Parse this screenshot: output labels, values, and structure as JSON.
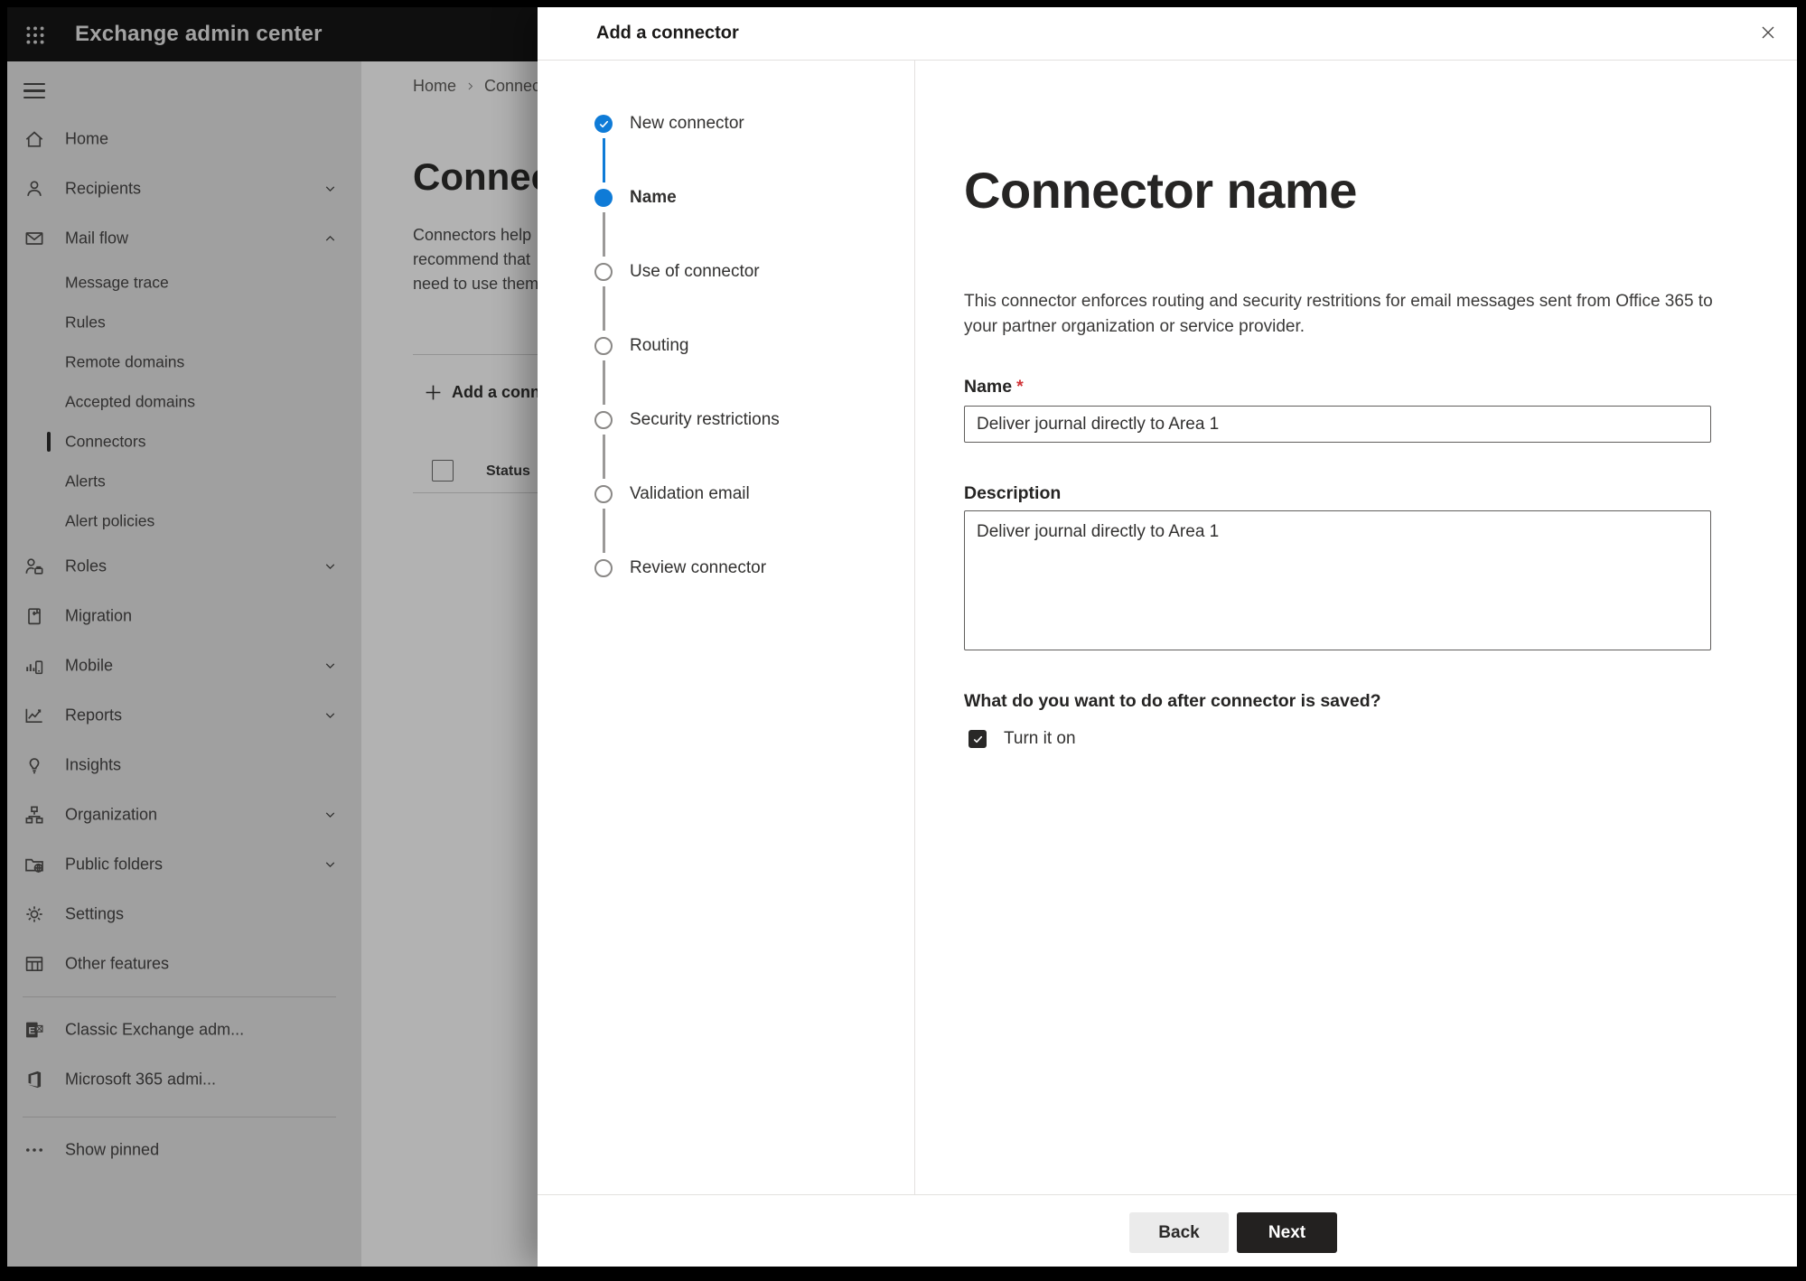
{
  "topbar": {
    "title": "Exchange admin center"
  },
  "sidebar": {
    "items": [
      {
        "label": "Home",
        "type": "top",
        "icon": "home-icon"
      },
      {
        "label": "Recipients",
        "type": "top",
        "icon": "recipients-icon",
        "chevron": "chevron-down-icon"
      },
      {
        "label": "Mail flow",
        "type": "top",
        "icon": "mail-flow-icon",
        "chevron": "chevron-up-icon"
      },
      {
        "label": "Message trace",
        "type": "sub"
      },
      {
        "label": "Rules",
        "type": "sub"
      },
      {
        "label": "Remote domains",
        "type": "sub"
      },
      {
        "label": "Accepted domains",
        "type": "sub"
      },
      {
        "label": "Connectors",
        "type": "sub",
        "selected": true
      },
      {
        "label": "Alerts",
        "type": "sub"
      },
      {
        "label": "Alert policies",
        "type": "sub"
      },
      {
        "label": "Roles",
        "type": "top",
        "icon": "roles-icon",
        "chevron": "chevron-down-icon"
      },
      {
        "label": "Migration",
        "type": "top",
        "icon": "migration-icon"
      },
      {
        "label": "Mobile",
        "type": "top",
        "icon": "mobile-icon",
        "chevron": "chevron-down-icon"
      },
      {
        "label": "Reports",
        "type": "top",
        "icon": "reports-icon",
        "chevron": "chevron-down-icon"
      },
      {
        "label": "Insights",
        "type": "top",
        "icon": "insights-icon"
      },
      {
        "label": "Organization",
        "type": "top",
        "icon": "organization-icon",
        "chevron": "chevron-down-icon"
      },
      {
        "label": "Public folders",
        "type": "top",
        "icon": "public-folders-icon",
        "chevron": "chevron-down-icon"
      },
      {
        "label": "Settings",
        "type": "top",
        "icon": "settings-icon"
      },
      {
        "label": "Other features",
        "type": "top",
        "icon": "other-features-icon"
      }
    ],
    "admin_links": [
      {
        "label": "Classic Exchange adm...",
        "type": "top",
        "icon": "classic-exchange-icon"
      },
      {
        "label": "Microsoft 365 admi...",
        "type": "top",
        "icon": "microsoft-365-icon"
      }
    ],
    "show_pinned_label": "Show pinned"
  },
  "page": {
    "breadcrumb": {
      "home": "Home",
      "current": "Connectors"
    },
    "title": "Connectors",
    "paragraph_lines": [
      "Connectors help",
      "recommend that",
      "need to use them"
    ],
    "add_button_label": "Add a connector",
    "status_header": "Status"
  },
  "dialog": {
    "title": "Add a connector",
    "steps": [
      {
        "label": "New connector",
        "state": "completed"
      },
      {
        "label": "Name",
        "state": "active"
      },
      {
        "label": "Use of connector",
        "state": "upcoming"
      },
      {
        "label": "Routing",
        "state": "upcoming"
      },
      {
        "label": "Security restrictions",
        "state": "upcoming"
      },
      {
        "label": "Validation email",
        "state": "upcoming"
      },
      {
        "label": "Review connector",
        "state": "upcoming"
      }
    ],
    "content": {
      "heading": "Connector name",
      "description": "This connector enforces routing and security restritions for email messages sent from Office 365 to your partner organization or service provider.",
      "name_label": "Name",
      "required_marker": "*",
      "name_value": "Deliver journal directly to Area 1",
      "description_label": "Description",
      "description_value": "Deliver journal directly to Area 1",
      "after_save_question": "What do you want to do after connector is saved?",
      "turn_on_label": "Turn it on",
      "turn_on_checked": true
    },
    "footer": {
      "back_label": "Back",
      "next_label": "Next"
    }
  },
  "colors": {
    "accent_blue": "#0f7bd7",
    "required_red": "#d13438",
    "primary_button": "#232120",
    "topbar_bg": "#161616",
    "overlay": "rgba(0,0,0,0.30)"
  }
}
